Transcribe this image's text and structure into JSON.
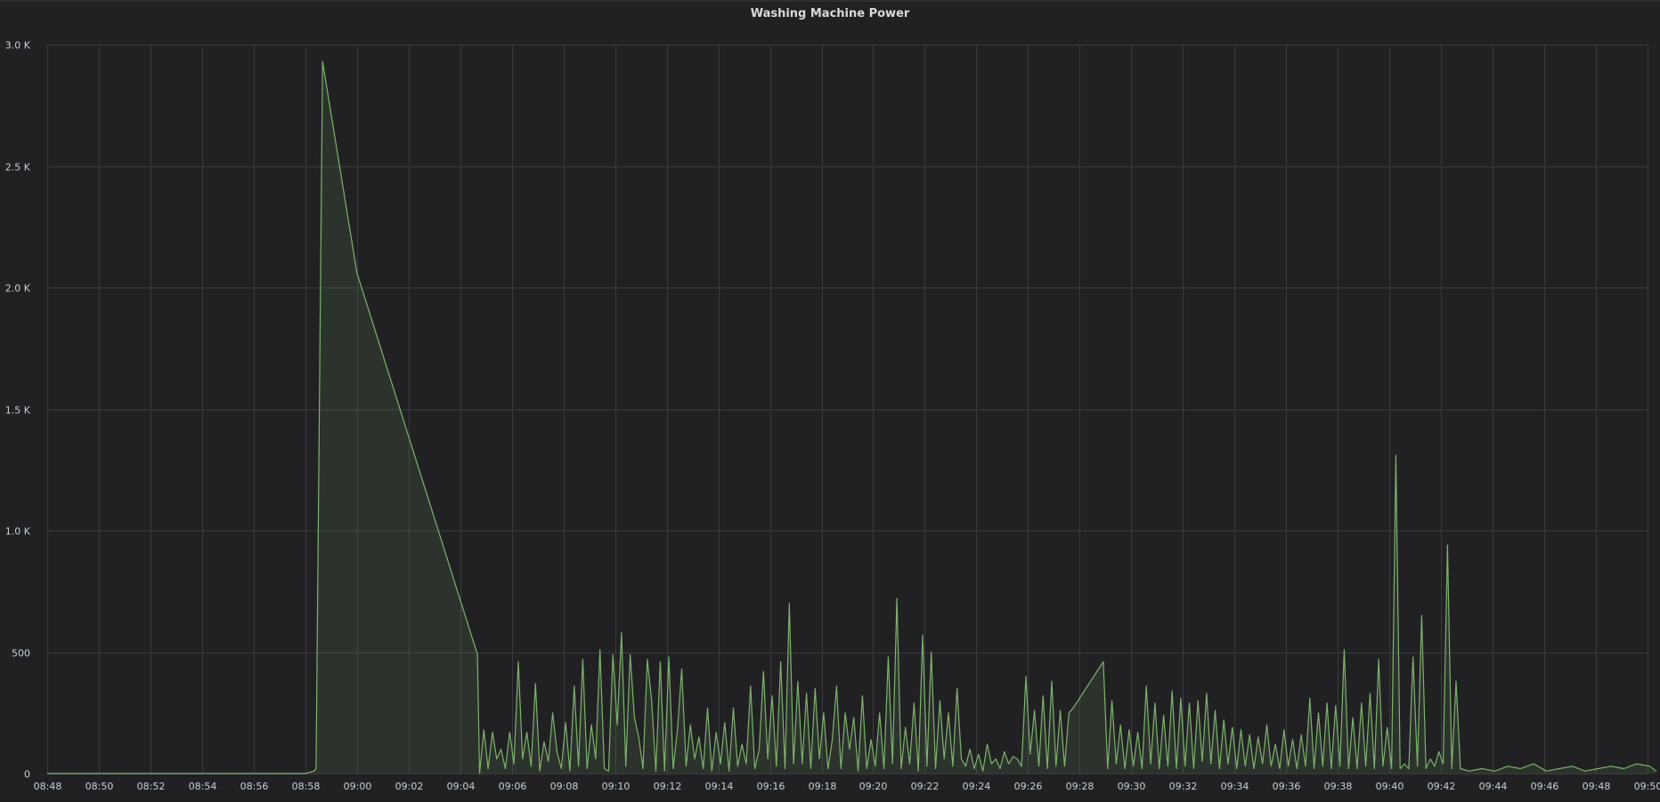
{
  "panel": {
    "title": "Washing Machine Power"
  },
  "chart_data": {
    "type": "area",
    "title": "Washing Machine Power",
    "xlabel": "",
    "ylabel": "",
    "grid": true,
    "legend": "none",
    "series_color": "#7eb26d",
    "fill_color": "#7eb26d",
    "xlim": [
      "08:48",
      "09:50"
    ],
    "ylim": [
      0,
      3000
    ],
    "y_ticks": [
      0,
      500,
      1000,
      1500,
      2000,
      2500,
      3000
    ],
    "y_tick_labels": [
      "0",
      "500",
      "1.0 K",
      "1.5 K",
      "2.0 K",
      "2.5 K",
      "3.0 K"
    ],
    "x_ticks": [
      "08:48",
      "08:50",
      "08:52",
      "08:54",
      "08:56",
      "08:58",
      "09:00",
      "09:02",
      "09:04",
      "09:06",
      "09:08",
      "09:10",
      "09:12",
      "09:14",
      "09:16",
      "09:18",
      "09:20",
      "09:22",
      "09:24",
      "09:26",
      "09:28",
      "09:30",
      "09:32",
      "09:34",
      "09:36",
      "09:38",
      "09:40",
      "09:42",
      "09:44",
      "09:46",
      "09:48",
      "09:50"
    ],
    "series": [
      {
        "points": [
          [
            "08:48:00",
            0
          ],
          [
            "08:52:00",
            0
          ],
          [
            "08:56:00",
            0
          ],
          [
            "08:58:00",
            0
          ],
          [
            "08:58:20",
            10
          ],
          [
            "08:58:25",
            20
          ],
          [
            "08:58:40",
            2930
          ],
          [
            "09:00:00",
            2060
          ],
          [
            "09:04:40",
            490
          ],
          [
            "09:04:45",
            0
          ],
          [
            "09:04:55",
            180
          ],
          [
            "09:05:05",
            20
          ],
          [
            "09:05:15",
            170
          ],
          [
            "09:05:25",
            60
          ],
          [
            "09:05:35",
            100
          ],
          [
            "09:05:45",
            20
          ],
          [
            "09:05:55",
            170
          ],
          [
            "09:06:05",
            40
          ],
          [
            "09:06:15",
            460
          ],
          [
            "09:06:25",
            60
          ],
          [
            "09:06:35",
            170
          ],
          [
            "09:06:45",
            30
          ],
          [
            "09:06:55",
            370
          ],
          [
            "09:07:05",
            10
          ],
          [
            "09:07:15",
            130
          ],
          [
            "09:07:25",
            50
          ],
          [
            "09:07:35",
            250
          ],
          [
            "09:07:45",
            90
          ],
          [
            "09:07:55",
            20
          ],
          [
            "09:08:05",
            210
          ],
          [
            "09:08:15",
            10
          ],
          [
            "09:08:25",
            360
          ],
          [
            "09:08:35",
            30
          ],
          [
            "09:08:45",
            470
          ],
          [
            "09:08:55",
            20
          ],
          [
            "09:09:05",
            200
          ],
          [
            "09:09:15",
            60
          ],
          [
            "09:09:25",
            510
          ],
          [
            "09:09:35",
            20
          ],
          [
            "09:09:45",
            10
          ],
          [
            "09:09:55",
            490
          ],
          [
            "09:10:05",
            200
          ],
          [
            "09:10:15",
            580
          ],
          [
            "09:10:25",
            30
          ],
          [
            "09:10:35",
            490
          ],
          [
            "09:10:45",
            230
          ],
          [
            "09:10:55",
            150
          ],
          [
            "09:11:05",
            20
          ],
          [
            "09:11:15",
            470
          ],
          [
            "09:11:25",
            300
          ],
          [
            "09:11:35",
            10
          ],
          [
            "09:11:45",
            460
          ],
          [
            "09:11:55",
            10
          ],
          [
            "09:12:05",
            480
          ],
          [
            "09:12:15",
            20
          ],
          [
            "09:12:25",
            180
          ],
          [
            "09:12:35",
            430
          ],
          [
            "09:12:45",
            30
          ],
          [
            "09:12:55",
            200
          ],
          [
            "09:13:05",
            60
          ],
          [
            "09:13:15",
            150
          ],
          [
            "09:13:25",
            20
          ],
          [
            "09:13:35",
            270
          ],
          [
            "09:13:45",
            10
          ],
          [
            "09:13:55",
            170
          ],
          [
            "09:14:05",
            40
          ],
          [
            "09:14:15",
            210
          ],
          [
            "09:14:25",
            10
          ],
          [
            "09:14:35",
            270
          ],
          [
            "09:14:45",
            30
          ],
          [
            "09:14:55",
            120
          ],
          [
            "09:15:05",
            40
          ],
          [
            "09:15:15",
            360
          ],
          [
            "09:15:25",
            20
          ],
          [
            "09:15:35",
            100
          ],
          [
            "09:15:45",
            420
          ],
          [
            "09:15:55",
            60
          ],
          [
            "09:16:05",
            320
          ],
          [
            "09:16:15",
            30
          ],
          [
            "09:16:25",
            460
          ],
          [
            "09:16:35",
            20
          ],
          [
            "09:16:45",
            700
          ],
          [
            "09:16:55",
            40
          ],
          [
            "09:17:05",
            380
          ],
          [
            "09:17:15",
            40
          ],
          [
            "09:17:25",
            330
          ],
          [
            "09:17:35",
            20
          ],
          [
            "09:17:45",
            350
          ],
          [
            "09:17:55",
            60
          ],
          [
            "09:18:05",
            250
          ],
          [
            "09:18:15",
            20
          ],
          [
            "09:18:25",
            140
          ],
          [
            "09:18:35",
            360
          ],
          [
            "09:18:45",
            20
          ],
          [
            "09:18:55",
            250
          ],
          [
            "09:19:05",
            100
          ],
          [
            "09:19:15",
            230
          ],
          [
            "09:19:25",
            10
          ],
          [
            "09:19:35",
            320
          ],
          [
            "09:19:45",
            20
          ],
          [
            "09:19:55",
            140
          ],
          [
            "09:20:05",
            30
          ],
          [
            "09:20:15",
            250
          ],
          [
            "09:20:25",
            20
          ],
          [
            "09:20:35",
            480
          ],
          [
            "09:20:45",
            40
          ],
          [
            "09:20:55",
            720
          ],
          [
            "09:21:05",
            20
          ],
          [
            "09:21:15",
            190
          ],
          [
            "09:21:25",
            40
          ],
          [
            "09:21:35",
            290
          ],
          [
            "09:21:45",
            10
          ],
          [
            "09:21:55",
            570
          ],
          [
            "09:22:05",
            30
          ],
          [
            "09:22:15",
            500
          ],
          [
            "09:22:25",
            20
          ],
          [
            "09:22:35",
            300
          ],
          [
            "09:22:45",
            60
          ],
          [
            "09:22:55",
            250
          ],
          [
            "09:23:05",
            30
          ],
          [
            "09:23:15",
            350
          ],
          [
            "09:23:25",
            60
          ],
          [
            "09:23:35",
            30
          ],
          [
            "09:23:45",
            100
          ],
          [
            "09:23:55",
            20
          ],
          [
            "09:24:05",
            80
          ],
          [
            "09:24:15",
            10
          ],
          [
            "09:24:25",
            120
          ],
          [
            "09:24:35",
            40
          ],
          [
            "09:24:45",
            60
          ],
          [
            "09:24:55",
            20
          ],
          [
            "09:25:05",
            90
          ],
          [
            "09:25:15",
            40
          ],
          [
            "09:25:25",
            70
          ],
          [
            "09:25:35",
            60
          ],
          [
            "09:25:45",
            30
          ],
          [
            "09:25:55",
            400
          ],
          [
            "09:26:05",
            80
          ],
          [
            "09:26:15",
            260
          ],
          [
            "09:26:25",
            30
          ],
          [
            "09:26:35",
            320
          ],
          [
            "09:26:45",
            20
          ],
          [
            "09:26:55",
            380
          ],
          [
            "09:27:05",
            30
          ],
          [
            "09:27:15",
            260
          ],
          [
            "09:27:25",
            30
          ],
          [
            "09:27:35",
            250
          ],
          [
            "09:27:45",
            270
          ],
          [
            "09:28:55",
            460
          ],
          [
            "09:29:05",
            20
          ],
          [
            "09:29:15",
            300
          ],
          [
            "09:29:25",
            40
          ],
          [
            "09:29:35",
            200
          ],
          [
            "09:29:45",
            20
          ],
          [
            "09:29:55",
            180
          ],
          [
            "09:30:05",
            30
          ],
          [
            "09:30:15",
            170
          ],
          [
            "09:30:25",
            20
          ],
          [
            "09:30:35",
            360
          ],
          [
            "09:30:45",
            40
          ],
          [
            "09:30:55",
            290
          ],
          [
            "09:31:05",
            20
          ],
          [
            "09:31:15",
            240
          ],
          [
            "09:31:25",
            30
          ],
          [
            "09:31:35",
            340
          ],
          [
            "09:31:45",
            20
          ],
          [
            "09:31:55",
            310
          ],
          [
            "09:32:05",
            30
          ],
          [
            "09:32:15",
            290
          ],
          [
            "09:32:25",
            20
          ],
          [
            "09:32:35",
            300
          ],
          [
            "09:32:45",
            50
          ],
          [
            "09:32:55",
            330
          ],
          [
            "09:33:05",
            40
          ],
          [
            "09:33:15",
            260
          ],
          [
            "09:33:25",
            20
          ],
          [
            "09:33:35",
            220
          ],
          [
            "09:33:45",
            40
          ],
          [
            "09:33:55",
            190
          ],
          [
            "09:34:05",
            20
          ],
          [
            "09:34:15",
            180
          ],
          [
            "09:34:25",
            30
          ],
          [
            "09:34:35",
            160
          ],
          [
            "09:34:45",
            20
          ],
          [
            "09:34:55",
            150
          ],
          [
            "09:35:05",
            40
          ],
          [
            "09:35:15",
            200
          ],
          [
            "09:35:25",
            30
          ],
          [
            "09:35:35",
            120
          ],
          [
            "09:35:45",
            20
          ],
          [
            "09:35:55",
            180
          ],
          [
            "09:36:05",
            30
          ],
          [
            "09:36:15",
            140
          ],
          [
            "09:36:25",
            20
          ],
          [
            "09:36:35",
            160
          ],
          [
            "09:36:45",
            30
          ],
          [
            "09:36:55",
            310
          ],
          [
            "09:37:05",
            20
          ],
          [
            "09:37:15",
            250
          ],
          [
            "09:37:25",
            30
          ],
          [
            "09:37:35",
            290
          ],
          [
            "09:37:45",
            20
          ],
          [
            "09:37:55",
            280
          ],
          [
            "09:38:05",
            30
          ],
          [
            "09:38:15",
            510
          ],
          [
            "09:38:25",
            20
          ],
          [
            "09:38:35",
            230
          ],
          [
            "09:38:45",
            20
          ],
          [
            "09:38:55",
            290
          ],
          [
            "09:39:05",
            30
          ],
          [
            "09:39:15",
            330
          ],
          [
            "09:39:25",
            20
          ],
          [
            "09:39:35",
            470
          ],
          [
            "09:39:45",
            30
          ],
          [
            "09:39:55",
            190
          ],
          [
            "09:40:05",
            20
          ],
          [
            "09:40:15",
            1310
          ],
          [
            "09:40:25",
            20
          ],
          [
            "09:40:35",
            40
          ],
          [
            "09:40:45",
            20
          ],
          [
            "09:40:55",
            480
          ],
          [
            "09:41:05",
            30
          ],
          [
            "09:41:15",
            650
          ],
          [
            "09:41:25",
            20
          ],
          [
            "09:41:35",
            60
          ],
          [
            "09:41:45",
            30
          ],
          [
            "09:41:55",
            90
          ],
          [
            "09:42:05",
            40
          ],
          [
            "09:42:15",
            940
          ],
          [
            "09:42:25",
            20
          ],
          [
            "09:42:35",
            380
          ],
          [
            "09:42:45",
            20
          ],
          [
            "09:43:05",
            10
          ],
          [
            "09:43:35",
            20
          ],
          [
            "09:44:05",
            10
          ],
          [
            "09:44:35",
            30
          ],
          [
            "09:45:05",
            20
          ],
          [
            "09:45:35",
            40
          ],
          [
            "09:46:05",
            10
          ],
          [
            "09:46:35",
            20
          ],
          [
            "09:47:05",
            30
          ],
          [
            "09:47:35",
            10
          ],
          [
            "09:48:05",
            20
          ],
          [
            "09:48:35",
            30
          ],
          [
            "09:49:05",
            20
          ],
          [
            "09:49:35",
            40
          ],
          [
            "09:50:05",
            30
          ],
          [
            "09:50:20",
            10
          ]
        ]
      }
    ]
  }
}
